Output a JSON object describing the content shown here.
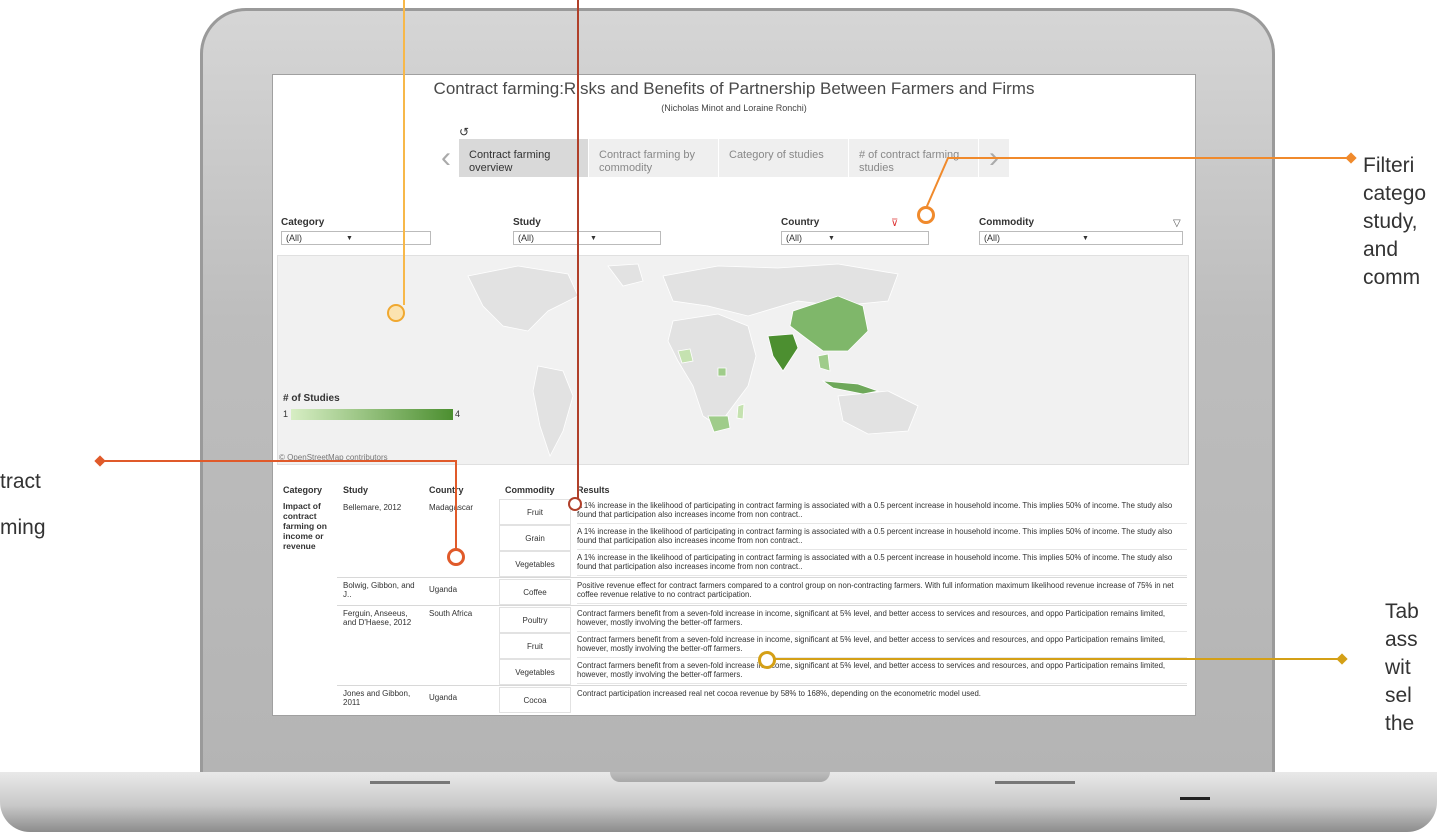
{
  "dashboard": {
    "title": "Contract farming:Risks and Benefits of Partnership Between Farmers and Firms",
    "subtitle": "(Nicholas Minot and Loraine Ronchi)",
    "undo_icon": "↺",
    "tabs": [
      {
        "label": "Contract farming overview",
        "active": true
      },
      {
        "label": "Contract farming by commodity",
        "active": false
      },
      {
        "label": "Category of studies",
        "active": false
      },
      {
        "label": "# of contract farming studies",
        "active": false
      }
    ],
    "filters": {
      "category": {
        "label": "Category",
        "value": "(All)"
      },
      "study": {
        "label": "Study",
        "value": "(All)"
      },
      "country": {
        "label": "Country",
        "value": "(All)"
      },
      "commodity": {
        "label": "Commodity",
        "value": "(All)"
      }
    },
    "map": {
      "legend_title": "# of Studies",
      "legend_min": "1",
      "legend_max": "4",
      "attribution": "© OpenStreetMap contributors",
      "colors": {
        "low": "#d7eec4",
        "high": "#4c8f30"
      }
    },
    "table": {
      "headers": {
        "category": "Category",
        "study": "Study",
        "country": "Country",
        "commodity": "Commodity",
        "results": "Results"
      },
      "category_value": "Impact of contract farming on income or revenue",
      "rows": [
        {
          "study": "Bellemare, 2012",
          "country": "Madagascar",
          "commodity": "Fruit",
          "result": "A 1% increase in the likelihood of participating in contract farming is associated with a 0.5 percent increase in household income. This implies 50% of income. The study also found that participation also increases income from non contract.."
        },
        {
          "study": "",
          "country": "",
          "commodity": "Grain",
          "result": "A 1% increase in the likelihood of participating in contract farming is associated with a 0.5 percent increase in household income. This implies 50% of income. The study also found that participation also increases income from non contract.."
        },
        {
          "study": "",
          "country": "",
          "commodity": "Vegetables",
          "result": "A 1% increase in the likelihood of participating in contract farming is associated with a 0.5 percent increase in household income. This implies 50% of income. The study also found that participation also increases income from non contract.."
        },
        {
          "study": "Bolwig, Gibbon, and J..",
          "country": "Uganda",
          "commodity": "Coffee",
          "result": "Positive revenue effect for contract farmers compared to a control group on non-contracting farmers. With full information maximum likelihood revenue increase of 75% in net coffee revenue relative to no contract participation."
        },
        {
          "study": "Ferguin, Anseeus, and D'Haese, 2012",
          "country": "South Africa",
          "commodity": "Poultry",
          "result": "Contract farmers benefit from a seven-fold increase in income, significant at 5% level, and better access to services and resources, and oppo Participation remains limited, however, mostly involving the better-off farmers."
        },
        {
          "study": "",
          "country": "",
          "commodity": "Fruit",
          "result": "Contract farmers benefit from a seven-fold increase in income, significant at 5% level, and better access to services and resources, and oppo Participation remains limited, however, mostly involving the better-off farmers."
        },
        {
          "study": "",
          "country": "",
          "commodity": "Vegetables",
          "result": "Contract farmers benefit from a seven-fold increase in income, significant at 5% level, and better access to services and resources, and oppo Participation remains limited, however, mostly involving the better-off farmers."
        },
        {
          "study": "Jones and Gibbon, 2011",
          "country": "Uganda",
          "commodity": "Cocoa",
          "result": "Contract participation increased real net cocoa revenue by 58% to 168%, depending on the econometric model used."
        }
      ]
    }
  },
  "annotations": {
    "filter_note": [
      "Filteri",
      "catego",
      "study,",
      "and",
      "comm"
    ],
    "left_note": [
      "tract",
      "ming"
    ],
    "table_note": [
      "Tab",
      "ass",
      "wit",
      "sel",
      "the"
    ],
    "colors": {
      "yellow": "#f7b84a",
      "red": "#b0402a",
      "orange": "#f08a2c",
      "gold": "#d4a017",
      "redorange": "#e05a2a"
    }
  }
}
